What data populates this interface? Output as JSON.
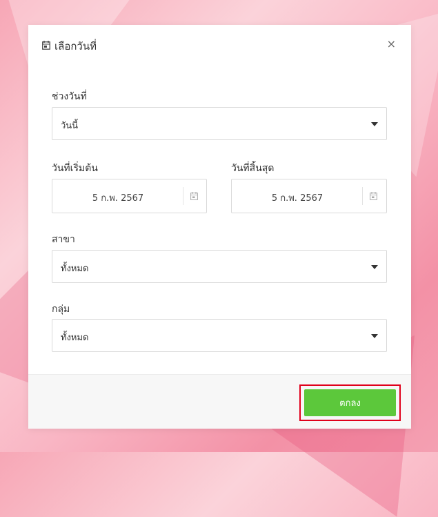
{
  "dialog": {
    "title": "เลือกวันที่",
    "close_label": "×"
  },
  "fields": {
    "date_range": {
      "label": "ช่วงวันที่",
      "value": "วันนี้"
    },
    "start_date": {
      "label": "วันที่เริ่มต้น",
      "value": "5 ก.พ. 2567"
    },
    "end_date": {
      "label": "วันที่สิ้นสุด",
      "value": "5 ก.พ. 2567"
    },
    "branch": {
      "label": "สาขา",
      "value": "ทั้งหมด"
    },
    "group": {
      "label": "กลุ่ม",
      "value": "ทั้งหมด"
    }
  },
  "footer": {
    "ok_label": "ตกลง"
  },
  "colors": {
    "ok_button": "#5cc83b",
    "highlight_outline": "#e0001b",
    "background_pink": "#f7a7b6"
  },
  "icons": {
    "title": "calendar-icon",
    "date_picker": "calendar-icon",
    "close": "close-icon",
    "dropdown": "caret-down-icon"
  }
}
